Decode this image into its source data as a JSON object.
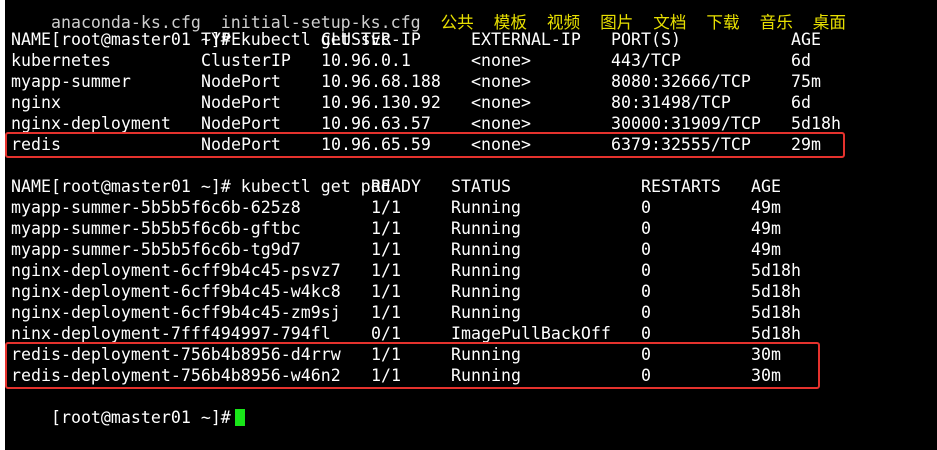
{
  "top_partial": {
    "text": "anaconda-ks.cfg  initial-setup-ks.cfg",
    "highlight": "公共  模板  视频  图片  文档  下载  音乐  桌面"
  },
  "prompt": "[root@master01 ~]#",
  "cmd_svc": {
    "command": "kubectl get svc",
    "headers": [
      "NAME",
      "TYPE",
      "CLUSTER-IP",
      "EXTERNAL-IP",
      "PORT(S)",
      "AGE"
    ],
    "rows": [
      [
        "kubernetes",
        "ClusterIP",
        "10.96.0.1",
        "<none>",
        "443/TCP",
        "6d"
      ],
      [
        "myapp-summer",
        "NodePort",
        "10.96.68.188",
        "<none>",
        "8080:32666/TCP",
        "75m"
      ],
      [
        "nginx",
        "NodePort",
        "10.96.130.92",
        "<none>",
        "80:31498/TCP",
        "6d"
      ],
      [
        "nginx-deployment",
        "NodePort",
        "10.96.63.57",
        "<none>",
        "30000:31909/TCP",
        "5d18h"
      ],
      [
        "redis",
        "NodePort",
        "10.96.65.59",
        "<none>",
        "6379:32555/TCP",
        "29m"
      ]
    ]
  },
  "cmd_pod": {
    "command": "kubectl get pod",
    "headers": [
      "NAME",
      "READY",
      "STATUS",
      "RESTARTS",
      "AGE"
    ],
    "rows": [
      [
        "myapp-summer-5b5b5f6c6b-625z8",
        "1/1",
        "Running",
        "0",
        "49m"
      ],
      [
        "myapp-summer-5b5b5f6c6b-gftbc",
        "1/1",
        "Running",
        "0",
        "49m"
      ],
      [
        "myapp-summer-5b5b5f6c6b-tg9d7",
        "1/1",
        "Running",
        "0",
        "49m"
      ],
      [
        "nginx-deployment-6cff9b4c45-psvz7",
        "1/1",
        "Running",
        "0",
        "5d18h"
      ],
      [
        "nginx-deployment-6cff9b4c45-w4kc8",
        "1/1",
        "Running",
        "0",
        "5d18h"
      ],
      [
        "nginx-deployment-6cff9b4c45-zm9sj",
        "1/1",
        "Running",
        "0",
        "5d18h"
      ],
      [
        "ninx-deployment-7fff494997-794fl",
        "0/1",
        "ImagePullBackOff",
        "0",
        "5d18h"
      ],
      [
        "redis-deployment-756b4b8956-d4rrw",
        "1/1",
        "Running",
        "0",
        "30m"
      ],
      [
        "redis-deployment-756b4b8956-w46n2",
        "1/1",
        "Running",
        "0",
        "30m"
      ]
    ]
  },
  "colors": {
    "background": "#000000",
    "text": "#ffffff",
    "highlight_box": "#e5322d",
    "cursor": "#19e619"
  }
}
